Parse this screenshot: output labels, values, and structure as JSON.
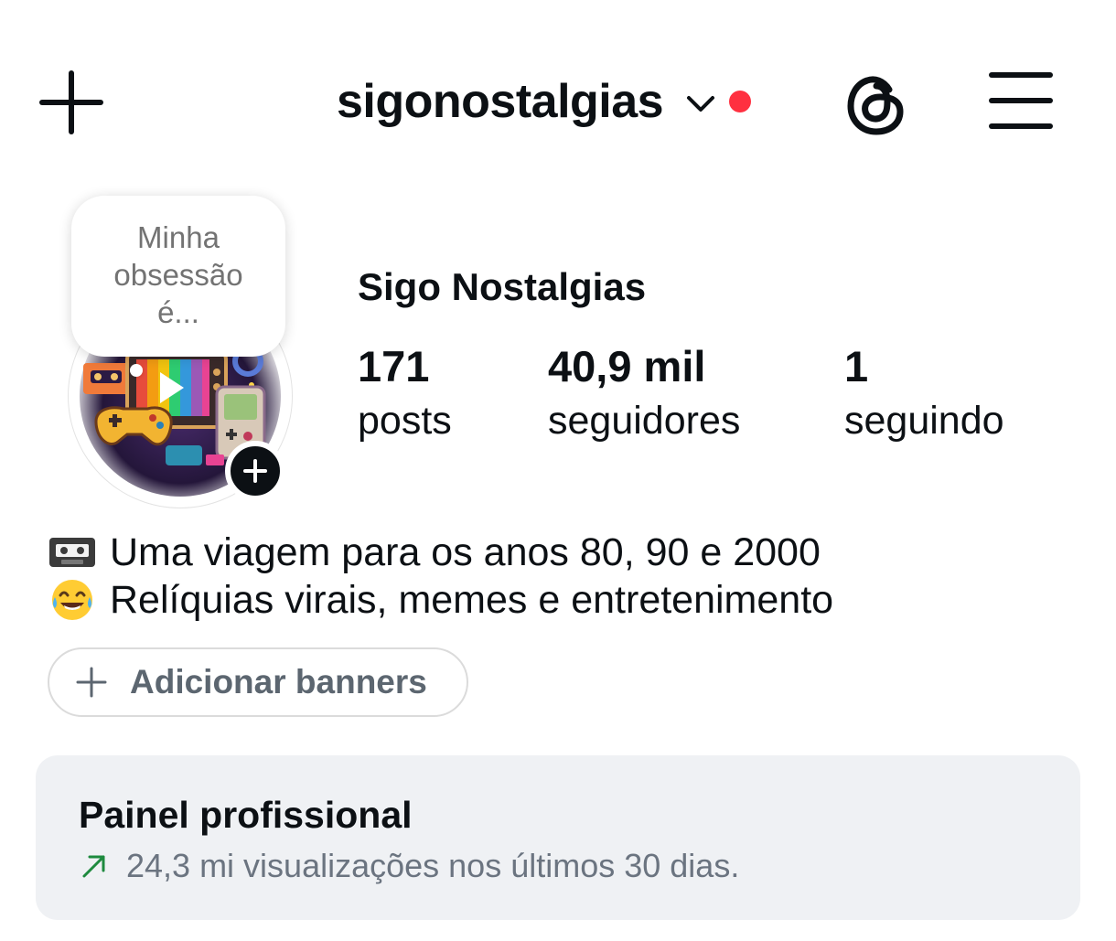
{
  "header": {
    "username": "sigonostalgias",
    "create_icon": "plus-icon",
    "chevron_icon": "chevron-down-icon",
    "threads_icon": "threads-icon",
    "menu_icon": "hamburger-menu-icon",
    "notification_color": "#ff3040"
  },
  "note": {
    "text": "Minha obsessão é..."
  },
  "profile": {
    "display_name": "Sigo Nostalgias",
    "avatar_add_icon": "plus-icon"
  },
  "stats": [
    {
      "value": "171",
      "label": "posts"
    },
    {
      "value": "40,9 mil",
      "label": "seguidores"
    },
    {
      "value": "1",
      "label": "seguindo"
    }
  ],
  "bio": [
    {
      "emoji": "videocassette-icon",
      "text": "Uma viagem para os anos 80, 90 e 2000"
    },
    {
      "emoji": "tears-of-joy-icon",
      "text": "Relíquias virais, memes e entretenimento"
    }
  ],
  "banner_button": {
    "label": "Adicionar banners",
    "icon": "plus-icon"
  },
  "dashboard": {
    "title": "Painel profissional",
    "subtitle": "24,3 mi visualizações nos últimos 30 dias.",
    "trend_icon": "arrow-up-right-icon",
    "trend_color": "#1e8a3e"
  }
}
